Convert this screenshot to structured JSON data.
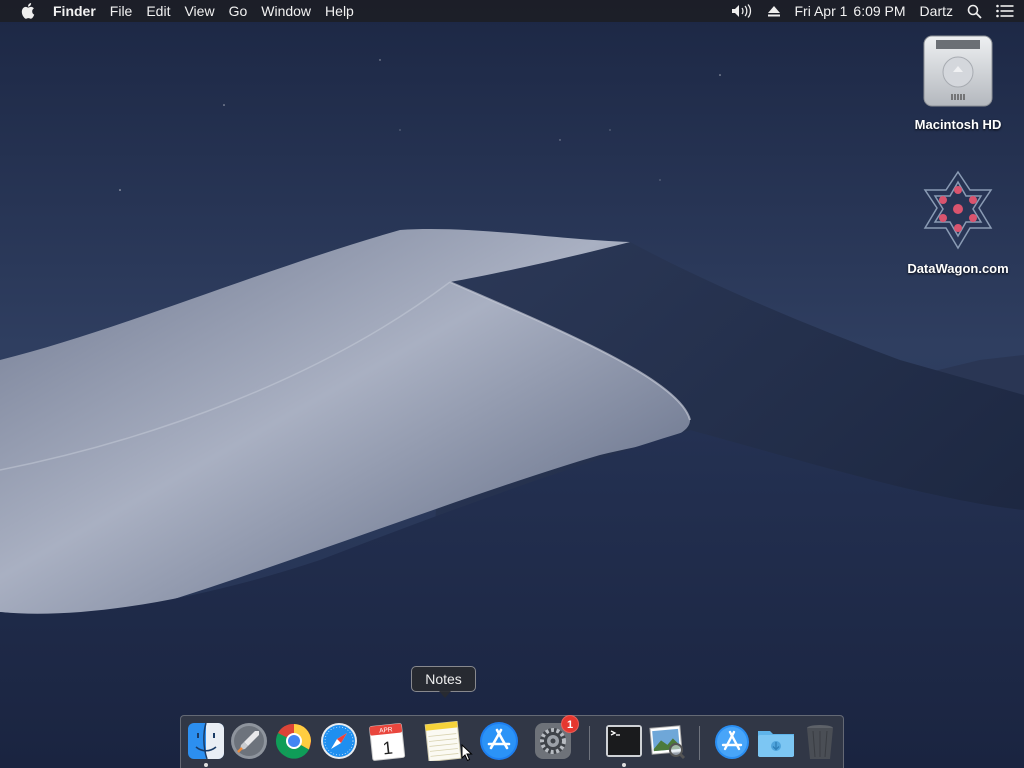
{
  "menubar": {
    "app_name": "Finder",
    "menus": [
      "File",
      "Edit",
      "View",
      "Go",
      "Window",
      "Help"
    ],
    "date": "Fri Apr 1",
    "time": "6:09 PM",
    "user": "Dartz",
    "icons": [
      "apple-icon",
      "volume-icon",
      "eject-icon",
      "spotlight-search-icon",
      "notification-center-icon"
    ]
  },
  "desktop": {
    "icons": [
      {
        "label": "Macintosh HD",
        "icon": "hard-drive-icon"
      },
      {
        "label": "DataWagon.com",
        "icon": "network-volume-icon"
      }
    ]
  },
  "tooltip": {
    "text": "Notes"
  },
  "dock": {
    "items": [
      {
        "name": "Finder",
        "icon": "finder-icon",
        "running": true
      },
      {
        "name": "Launchpad",
        "icon": "launchpad-icon",
        "running": false
      },
      {
        "name": "Google Chrome",
        "icon": "chrome-icon",
        "running": false
      },
      {
        "name": "Safari",
        "icon": "safari-icon",
        "running": false
      },
      {
        "name": "Calendar",
        "icon": "calendar-icon",
        "running": false,
        "month": "APR",
        "day": "1"
      },
      {
        "name": "Notes",
        "icon": "notes-icon",
        "running": false
      },
      {
        "name": "App Store",
        "icon": "app-store-icon",
        "running": false
      },
      {
        "name": "System Preferences",
        "icon": "system-preferences-icon",
        "running": false,
        "badge": "1"
      },
      {
        "name": "Terminal",
        "icon": "terminal-icon",
        "running": true
      },
      {
        "name": "Preview",
        "icon": "preview-icon",
        "running": false
      },
      {
        "name": "Applications",
        "icon": "applications-folder-icon",
        "running": false
      },
      {
        "name": "Downloads",
        "icon": "downloads-folder-icon",
        "running": false
      },
      {
        "name": "Trash",
        "icon": "trash-icon",
        "running": false
      }
    ]
  },
  "colors": {
    "sky_top": "#1c2744",
    "sky_mid": "#2d3c5e",
    "dune_light": "#9aa3b6",
    "dune_shadow": "#1b2640",
    "badge": "#e5372f"
  }
}
